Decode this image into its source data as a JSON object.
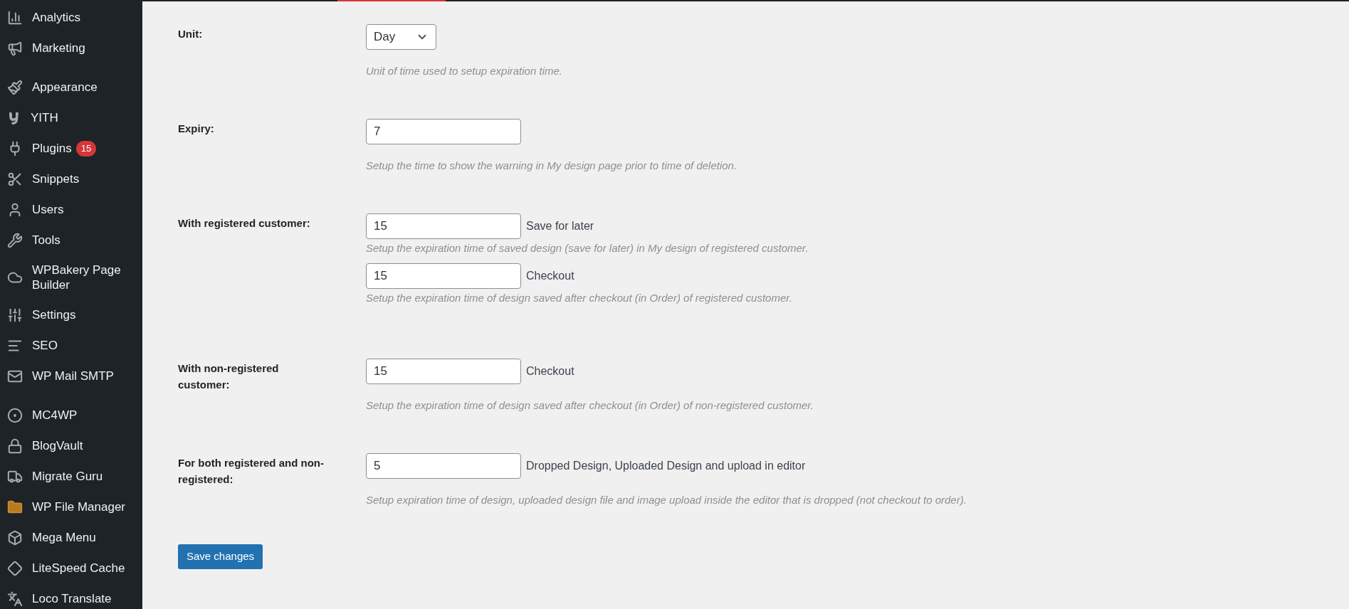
{
  "sidebar": {
    "groups": [
      [
        {
          "label": "Analytics"
        },
        {
          "label": "Marketing"
        }
      ],
      [
        {
          "label": "Appearance"
        },
        {
          "label": "YITH"
        },
        {
          "label": "Plugins",
          "badge": "15"
        },
        {
          "label": "Snippets"
        },
        {
          "label": "Users"
        },
        {
          "label": "Tools"
        },
        {
          "label": "WPBakery Page Builder"
        },
        {
          "label": "Settings"
        },
        {
          "label": "SEO"
        },
        {
          "label": "WP Mail SMTP"
        }
      ],
      [
        {
          "label": "MC4WP"
        },
        {
          "label": "BlogVault"
        },
        {
          "label": "Migrate Guru"
        },
        {
          "label": "WP File Manager"
        },
        {
          "label": "Mega Menu"
        },
        {
          "label": "LiteSpeed Cache"
        },
        {
          "label": "Loco Translate"
        }
      ]
    ]
  },
  "form": {
    "rows": [
      {
        "label": "Unit:",
        "fields": [
          {
            "kind": "select",
            "value": "Day",
            "hint": "Unit of time used to setup expiration time."
          }
        ]
      },
      {
        "label": "Expiry:",
        "fields": [
          {
            "kind": "input",
            "value": "7",
            "hint": "Setup the time to show the warning in My design page prior to time of deletion."
          }
        ]
      },
      {
        "label": "With registered customer:",
        "fields": [
          {
            "kind": "input",
            "value": "15",
            "suffix": "Save for later",
            "hint": "Setup the expiration time of saved design (save for later) in My design of registered customer."
          },
          {
            "kind": "input",
            "value": "15",
            "suffix": "Checkout",
            "hint": "Setup the expiration time of design saved after checkout (in Order) of registered customer."
          }
        ]
      },
      {
        "label": "With non-registered customer:",
        "fields": [
          {
            "kind": "input",
            "value": "15",
            "suffix": "Checkout",
            "hint": "Setup the expiration time of design saved after checkout (in Order) of non-registered customer."
          }
        ]
      },
      {
        "label": "For both registered and non-registered:",
        "fields": [
          {
            "kind": "input",
            "value": "5",
            "suffix": "Dropped Design, Uploaded Design and upload in editor",
            "hint": "Setup expiration time of design, uploaded design file and image upload inside the editor that is dropped (not checkout to order)."
          }
        ]
      }
    ],
    "submit": "Save changes"
  }
}
